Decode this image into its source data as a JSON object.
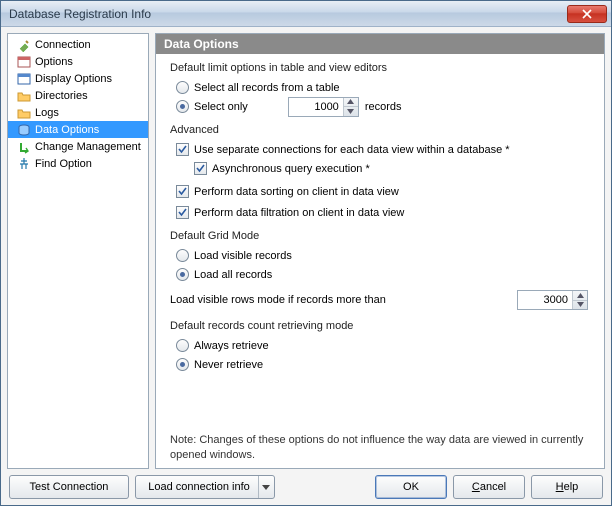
{
  "window": {
    "title": "Database Registration Info"
  },
  "tree": {
    "items": [
      {
        "label": "Connection",
        "icon": "plug"
      },
      {
        "label": "Options",
        "icon": "form"
      },
      {
        "label": "Display Options",
        "icon": "display"
      },
      {
        "label": "Directories",
        "icon": "folder"
      },
      {
        "label": "Logs",
        "icon": "folder"
      },
      {
        "label": "Data Options",
        "icon": "data",
        "selected": true
      },
      {
        "label": "Change Management",
        "icon": "change"
      },
      {
        "label": "Find Option",
        "icon": "find"
      }
    ]
  },
  "panel": {
    "title": "Data Options"
  },
  "limit": {
    "group_title": "Default limit options in table and view editors",
    "select_all": "Select all records from a table",
    "select_only": "Select only",
    "value": "1000",
    "records_suffix": "records"
  },
  "advanced": {
    "group_title": "Advanced",
    "separate_conn": "Use separate connections for each data view within a database *",
    "async_query": "Asynchronous query execution *",
    "sort_client": "Perform data sorting on client in data view",
    "filter_client": "Perform data filtration on client in data view"
  },
  "grid": {
    "group_title": "Default Grid Mode",
    "load_visible": "Load visible records",
    "load_all": "Load all records",
    "more_than_label": "Load visible rows mode if records more than",
    "more_than_value": "3000"
  },
  "retrieve": {
    "group_title": "Default records count retrieving mode",
    "always": "Always retrieve",
    "never": "Never retrieve"
  },
  "note": "Note: Changes of these options do not influence the way data are viewed in currently opened windows.",
  "buttons": {
    "test": "Test Connection",
    "load": "Load connection info",
    "ok": "OK",
    "cancel_pre": "",
    "cancel_key": "C",
    "cancel_post": "ancel",
    "help_pre": "",
    "help_key": "H",
    "help_post": "elp"
  }
}
